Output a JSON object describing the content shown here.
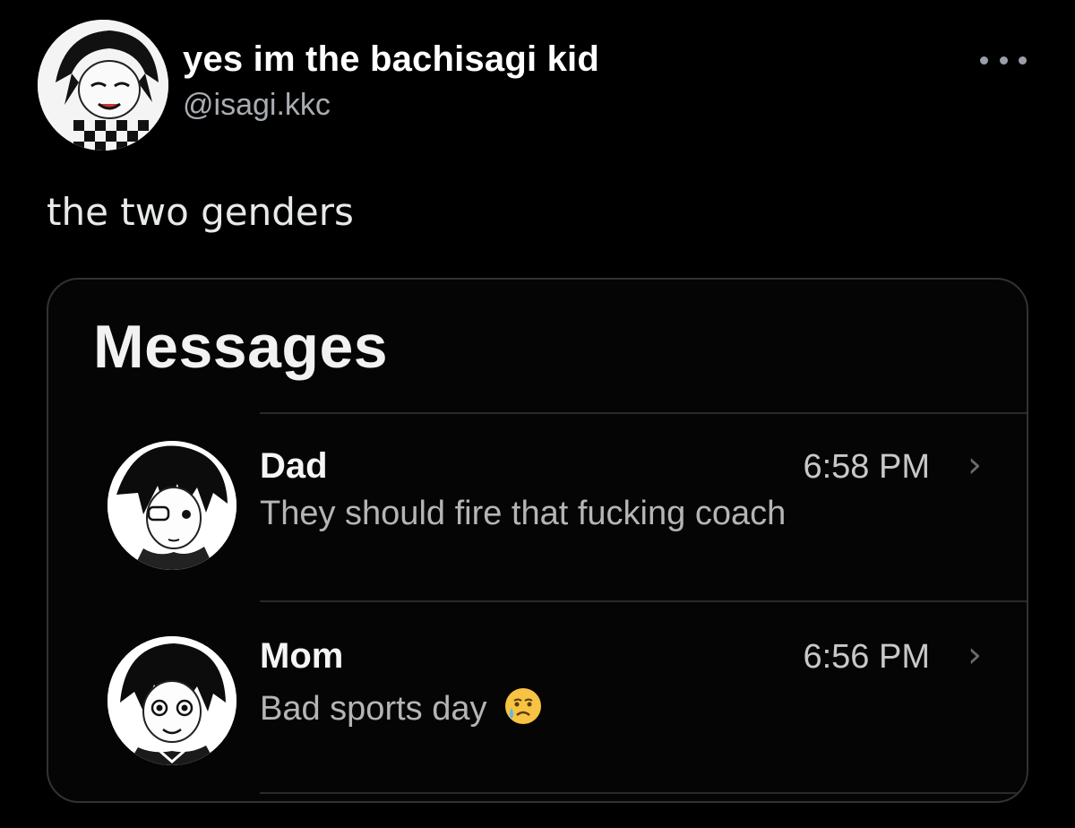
{
  "tweet": {
    "display_name": "yes im the bachisagi kid",
    "handle": "@isagi.kkc",
    "text": "the two genders",
    "more_icon": "more-dots-icon"
  },
  "messages_card": {
    "title": "Messages",
    "conversations": [
      {
        "name": "Dad",
        "time": "6:58 PM",
        "preview": "They should fire that fucking coach",
        "avatar_icon": "manga-avatar-dad"
      },
      {
        "name": "Mom",
        "time": "6:56 PM",
        "preview": "Bad sports day",
        "emoji": "crying-face-emoji",
        "avatar_icon": "manga-avatar-mom"
      }
    ],
    "chevron_icon": "chevron-right-icon"
  }
}
